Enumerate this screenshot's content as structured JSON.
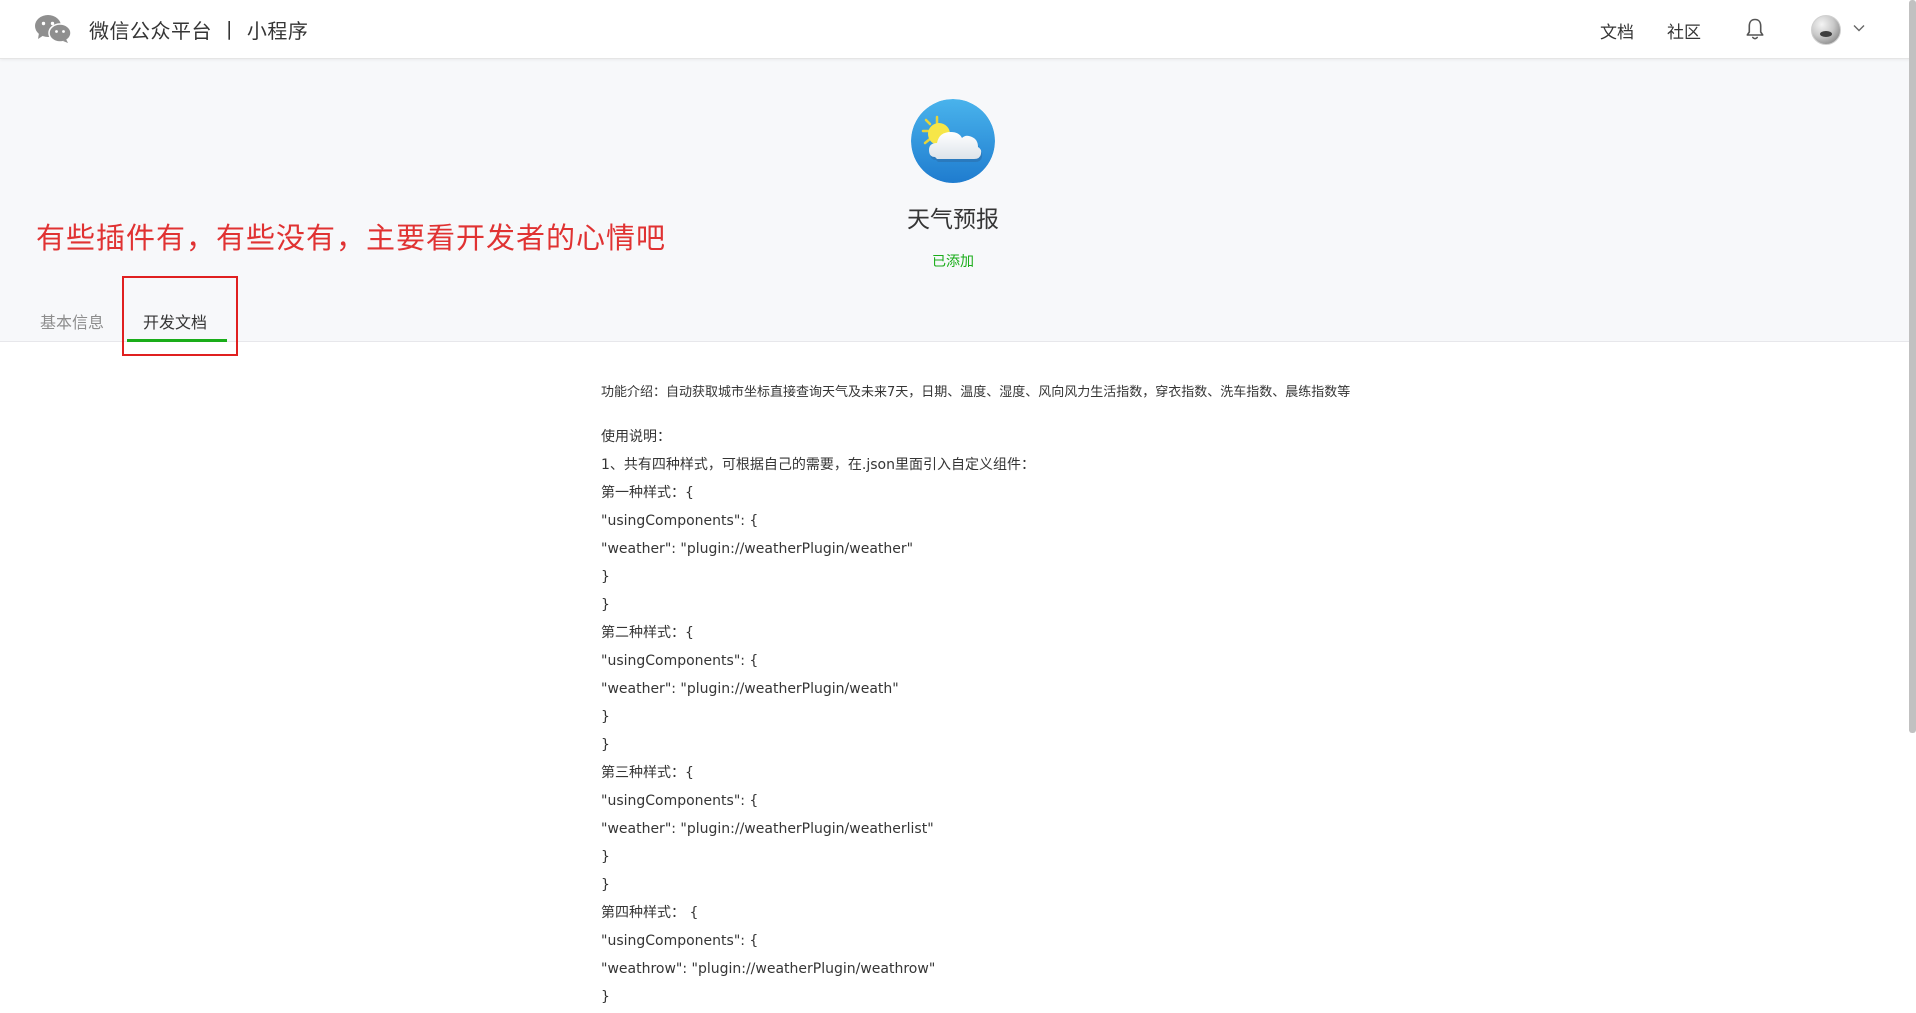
{
  "topbar": {
    "logo_icon": "wechat-logo-icon",
    "platform_name": "微信公众平台",
    "separator": "|",
    "section_name": "小程序",
    "nav": {
      "docs": "文档",
      "community": "社区"
    },
    "bell_icon": "bell-icon",
    "avatar_icon": "avatar",
    "caret_icon": "chevron-down-icon"
  },
  "plugin": {
    "icon": "weather-icon",
    "name": "天气预报",
    "status": "已添加"
  },
  "annotation": "有些插件有，有些没有，主要看开发者的心情吧",
  "tabs": [
    {
      "label": "基本信息",
      "active": false
    },
    {
      "label": "开发文档",
      "active": true
    }
  ],
  "doc": {
    "intro": "功能介绍：自动获取城市坐标直接查询天气及未来7天，日期、温度、湿度、风向风力生活指数，穿衣指数、洗车指数、晨练指数等",
    "lines": [
      "使用说明：",
      "1、共有四种样式，可根据自己的需要，在.json里面引入自定义组件：",
      "第一种样式：{",
      "\"usingComponents\": {",
      "\"weather\": \"plugin://weatherPlugin/weather\"",
      "}",
      "}",
      "第二种样式：{",
      "\"usingComponents\": {",
      "\"weather\": \"plugin://weatherPlugin/weath\"",
      "}",
      "}",
      "第三种样式：{",
      "\"usingComponents\": {",
      "\"weather\": \"plugin://weatherPlugin/weatherlist\"",
      "}",
      "}",
      "第四种样式： {",
      "\"usingComponents\": {",
      "\"weathrow\": \"plugin://weatherPlugin/weathrow\"",
      "}"
    ]
  },
  "colors": {
    "accent_green": "#1aad19",
    "annotation_red": "#e03232",
    "header_bg": "#f7f8fa"
  }
}
